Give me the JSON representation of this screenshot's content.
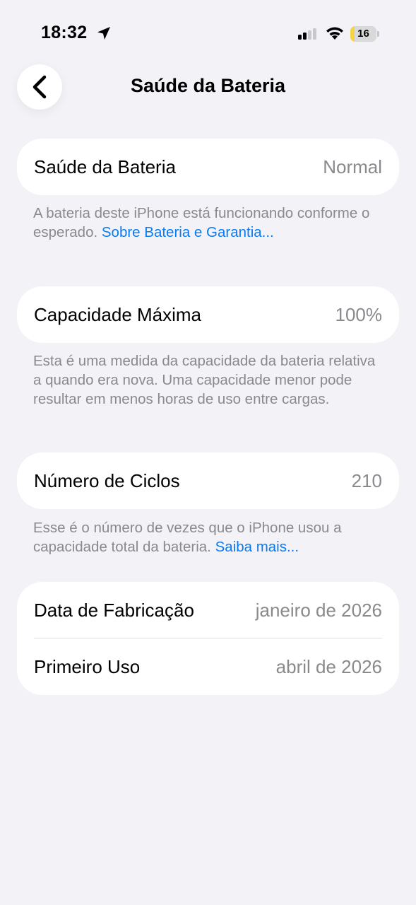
{
  "status_bar": {
    "time": "18:32",
    "battery_level": "16",
    "battery_fraction": 0.16,
    "icons": [
      "location-arrow-icon",
      "cellular-signal-icon",
      "wifi-icon",
      "battery-icon"
    ]
  },
  "nav": {
    "back_icon": "chevron-left-icon",
    "title": "Saúde da Bateria"
  },
  "battery_health": {
    "label": "Saúde da Bateria",
    "value": "Normal",
    "footer_text": "A bateria deste iPhone está funcionando conforme o esperado. ",
    "footer_link": "Sobre Bateria e Garantia..."
  },
  "max_capacity": {
    "label": "Capacidade Máxima",
    "value": "100%",
    "footer_text": "Esta é uma medida da capacidade da bateria relativa a quando era nova. Uma capacidade menor pode resultar em menos horas de uso entre cargas."
  },
  "cycle_count": {
    "label": "Número de Ciclos",
    "value": "210",
    "footer_text": "Esse é o número de vezes que o iPhone usou a capacidade total da bateria. ",
    "footer_link": "Saiba mais..."
  },
  "dates": {
    "manufacture_label": "Data de Fabricação",
    "manufacture_value": "janeiro de 2026",
    "first_use_label": "Primeiro Uso",
    "first_use_value": "abril de 2026"
  },
  "colors": {
    "background": "#f2f2f7",
    "card": "#ffffff",
    "secondary_text": "#8a8a8e",
    "link": "#0a7bf0",
    "battery_fill": "#f5d547"
  }
}
